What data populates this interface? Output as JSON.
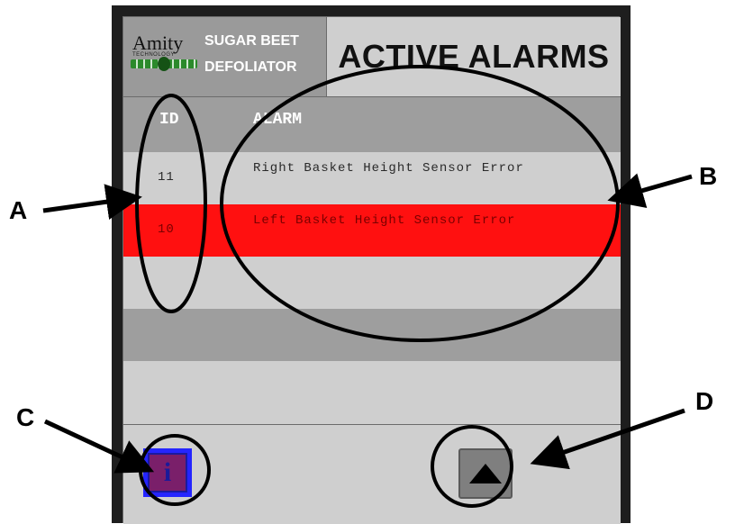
{
  "header": {
    "logo_brand": "Amity",
    "logo_sub": "TECHNOLOGY",
    "logo_line1": "SUGAR BEET",
    "logo_line2": "DEFOLIATOR",
    "title": "ACTIVE ALARMS"
  },
  "table": {
    "columns": [
      "ID",
      "ALARM"
    ],
    "rows": [
      {
        "id": "11",
        "message": "Right Basket Height Sensor Error",
        "status": "normal"
      },
      {
        "id": "10",
        "message": "Left Basket Height Sensor Error",
        "status": "active"
      }
    ]
  },
  "buttons": {
    "info_glyph": "i",
    "scroll_up_icon": "triangle-up-icon"
  },
  "annotations": {
    "A": "A",
    "B": "B",
    "C": "C",
    "D": "D"
  },
  "colors": {
    "active_alarm_row": "#ff1010",
    "info_button": "#2525ff",
    "info_inner": "#7a1f6a"
  }
}
